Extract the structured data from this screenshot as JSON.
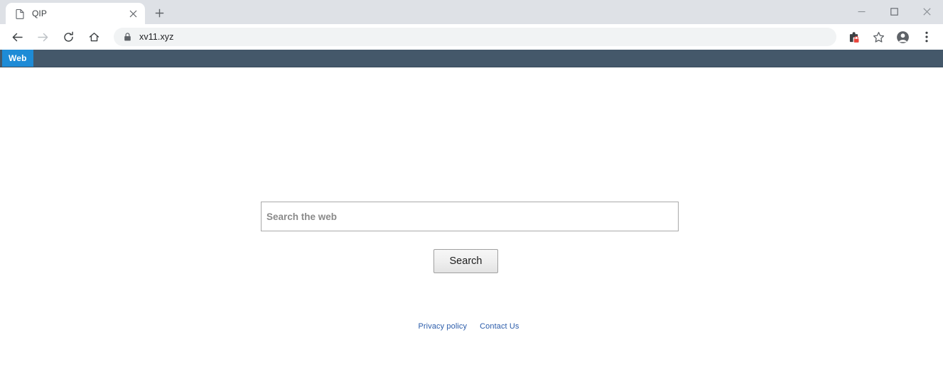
{
  "window": {
    "minimize_label": "minimize-icon",
    "maximize_label": "maximize-icon",
    "close_label": "close-icon"
  },
  "tabstrip": {
    "tabs": [
      {
        "title": "QIP",
        "favicon": "page-icon",
        "close_label": "×"
      }
    ],
    "new_tab_label": "+"
  },
  "toolbar": {
    "back_label": "back-icon",
    "forward_label": "forward-icon",
    "reload_label": "reload-icon",
    "home_label": "home-icon",
    "lock_label": "lock-icon",
    "url": "xv11.xyz",
    "extension_label": "extension-icon",
    "bookmark_label": "star-icon",
    "profile_label": "account-icon",
    "menu_label": "more-menu-icon"
  },
  "site": {
    "nav_tab_label": "Web",
    "bar_color": "#44586a",
    "tab_color": "#1e8bd6",
    "search": {
      "placeholder": "Search the web",
      "value": "",
      "button_label": "Search"
    },
    "footer": {
      "links": [
        {
          "label": "Privacy policy"
        },
        {
          "label": "Contact Us"
        }
      ],
      "link_color": "#2b5caa"
    }
  }
}
